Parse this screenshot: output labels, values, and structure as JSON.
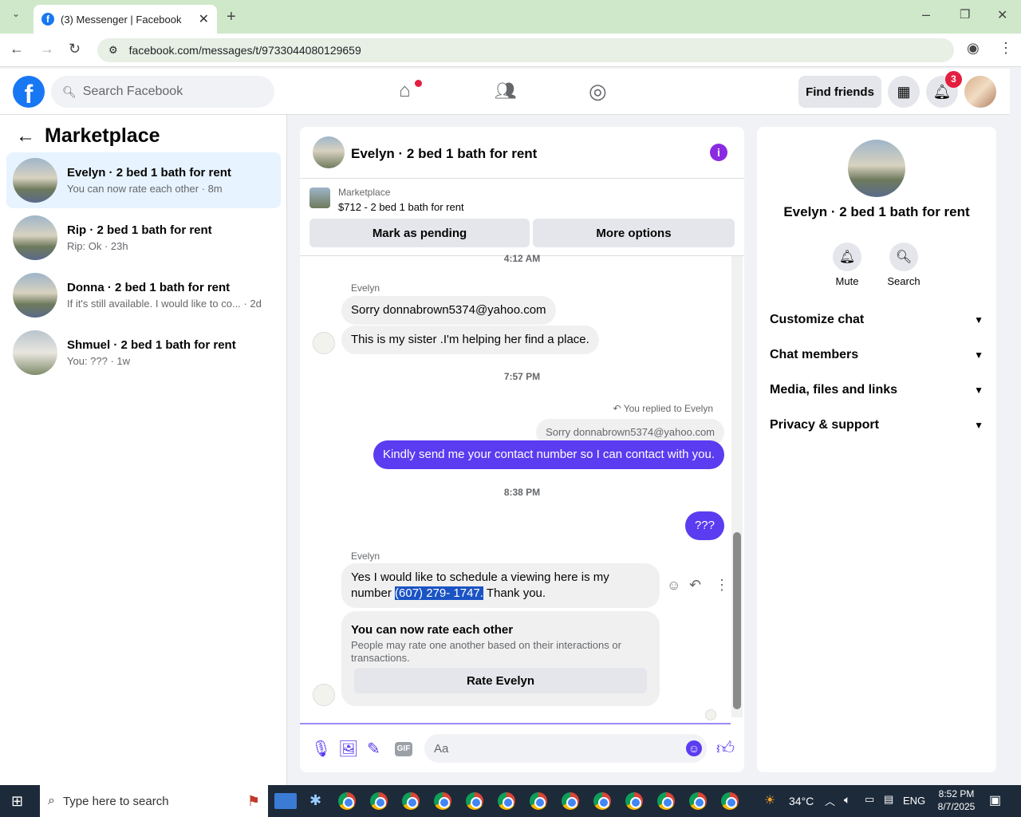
{
  "browser": {
    "tab_title": "(3) Messenger | Facebook",
    "url": "facebook.com/messages/t/9733044080129659"
  },
  "header": {
    "search_placeholder": "Search Facebook",
    "find_friends": "Find friends",
    "notification_count": "3"
  },
  "sidebar": {
    "title": "Marketplace",
    "conversations": [
      {
        "name": "Evelyn · 2 bed 1 bath for rent",
        "preview": "You can now rate each other · 8m"
      },
      {
        "name": "Rip · 2 bed 1 bath for rent",
        "preview": "Rip: Ok · 23h"
      },
      {
        "name": "Donna · 2 bed 1 bath for rent",
        "preview": "If it's still available. I would like to co...",
        "time": "· 2d"
      },
      {
        "name": "Shmuel · 2 bed 1 bath for rent",
        "preview": "You: ??? · 1w"
      }
    ]
  },
  "chat": {
    "title": "Evelyn · 2 bed 1 bath for rent",
    "listing_label": "Marketplace",
    "listing_title": "$712 - 2 bed 1 bath for rent",
    "mark_pending": "Mark as pending",
    "more_options": "More options",
    "messages": {
      "ts1": "4:12 AM",
      "sender1": "Evelyn",
      "m1": "Sorry donnabrown5374@yahoo.com",
      "m2": "This is my sister .I'm helping her find a place.",
      "ts2": "7:57 PM",
      "replied": "You replied to Evelyn",
      "quoted": "Sorry donnabrown5374@yahoo.com",
      "m3": "Kindly send me your contact number so I can contact with you.",
      "ts3": "8:38 PM",
      "m4": "???",
      "sender2": "Evelyn",
      "m5a": "Yes I would like to schedule a viewing here is my",
      "m5b": "number ",
      "m5hl": "(607)  279- 1747.",
      "m5c": " Thank you.",
      "rate_title": "You can now rate each other",
      "rate_desc": "People may rate one another based on their interactions or transactions.",
      "rate_button": "Rate Evelyn"
    },
    "composer_placeholder": "Aa"
  },
  "details": {
    "title": "Evelyn · 2 bed 1 bath for rent",
    "mute": "Mute",
    "search": "Search",
    "sections": [
      "Customize chat",
      "Chat members",
      "Media, files and links",
      "Privacy & support"
    ]
  },
  "taskbar": {
    "search": "Type here to search",
    "temp": "34°C",
    "lang": "ENG",
    "time": "8:52 PM",
    "date": "8/7/2025"
  },
  "colors": {
    "accent": "#5b3cf0",
    "fb_blue": "#1877f2",
    "highlight": "#1a53c4"
  }
}
